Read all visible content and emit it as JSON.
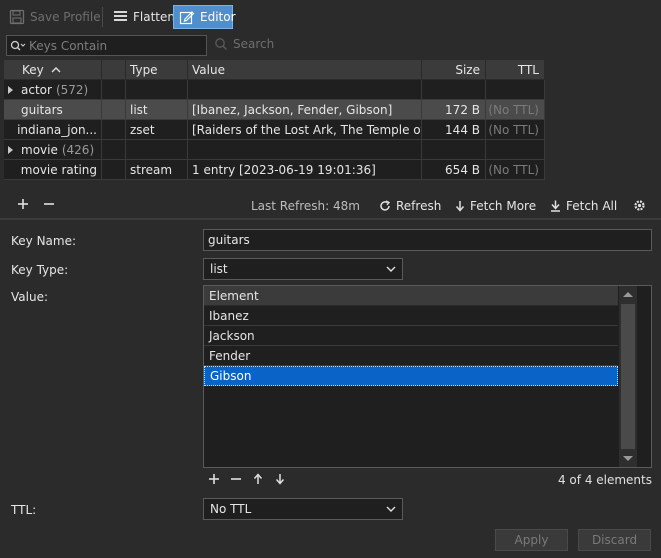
{
  "toolbar": {
    "save_profile": "Save Profile",
    "flatten": "Flatten",
    "editor": "Editor"
  },
  "filter": {
    "placeholder": "Keys Contain",
    "search_label": "Search"
  },
  "table": {
    "headers": [
      "Key",
      "Type",
      "Value",
      "Size",
      "TTL"
    ],
    "rows": [
      {
        "key": "actor",
        "count": "(572)",
        "type": "",
        "value": "",
        "size": "",
        "ttl": ""
      },
      {
        "key": "guitars",
        "count": "",
        "type": "list",
        "value": "[Ibanez, Jackson, Fender, Gibson]",
        "size": "172 B",
        "ttl": "(No TTL)"
      },
      {
        "key": "indiana_jon...",
        "count": "",
        "type": "zset",
        "value": "[Raiders of the Lost Ark, The Temple of ...",
        "size": "144 B",
        "ttl": "(No TTL)"
      },
      {
        "key": "movie",
        "count": "(426)",
        "type": "",
        "value": "",
        "size": "",
        "ttl": ""
      },
      {
        "key": "movie rating",
        "count": "",
        "type": "stream",
        "value": "1 entry [2023-06-19 19:01:36]",
        "size": "654 B",
        "ttl": "(No TTL)"
      }
    ]
  },
  "tablebar": {
    "last_refresh": "Last Refresh: 48m",
    "refresh": "Refresh",
    "fetch_more": "Fetch More",
    "fetch_all": "Fetch All"
  },
  "editor": {
    "key_name_label": "Key Name:",
    "key_name_value": "guitars",
    "key_type_label": "Key Type:",
    "key_type_value": "list",
    "value_label": "Value:",
    "list_header": "Element",
    "elements": [
      "Ibanez",
      "Jackson",
      "Fender",
      "Gibson"
    ],
    "element_count": "4 of 4 elements",
    "ttl_label": "TTL:",
    "ttl_value": "No TTL",
    "apply": "Apply",
    "discard": "Discard"
  },
  "colors": {
    "background": "#2b2b2b",
    "selection": "#0a64c8",
    "active_button": "#4f8fce"
  }
}
